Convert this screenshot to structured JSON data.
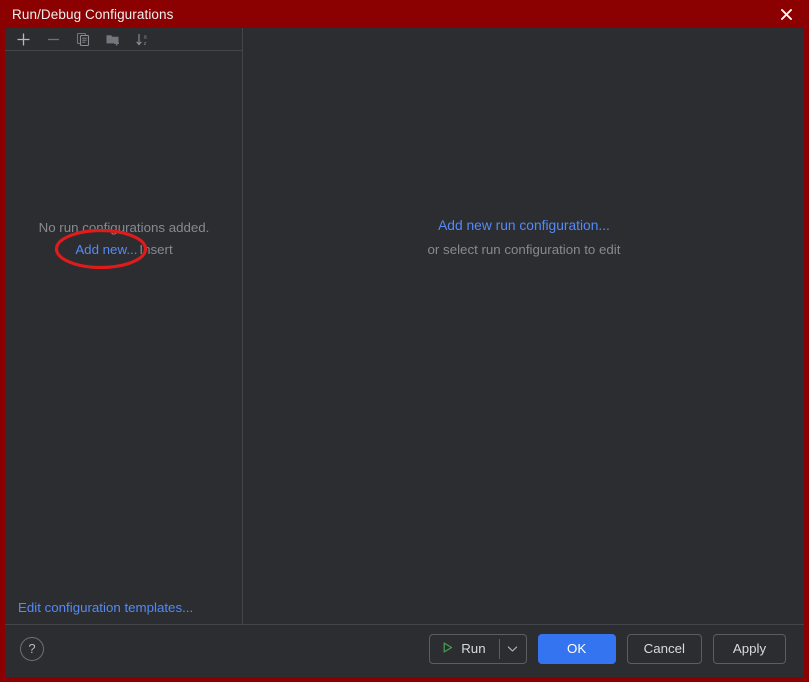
{
  "window": {
    "title": "Run/Debug Configurations",
    "close_icon": "close-icon",
    "titlebar_color": "#8b0000",
    "background_color": "#2b2d30"
  },
  "toolbar": {
    "items": [
      {
        "name": "add-icon",
        "label": "Add New Configuration"
      },
      {
        "name": "remove-icon",
        "label": "Remove Configuration"
      },
      {
        "name": "copy-icon",
        "label": "Copy Configuration"
      },
      {
        "name": "new-folder-icon",
        "label": "Create New Folder"
      },
      {
        "name": "sort-alphabetically-icon",
        "label": "Sort Configurations"
      }
    ]
  },
  "left_panel": {
    "empty_message": "No run configurations added.",
    "add_new_link": "Add new...",
    "add_new_shortcut": "Insert",
    "edit_templates_link": "Edit configuration templates..."
  },
  "right_panel": {
    "primary_link": "Add new run configuration...",
    "subtitle": "or select run configuration to edit"
  },
  "footer": {
    "help_label": "?",
    "run_label": "Run",
    "run_dropdown_icon": "chevron-down-icon",
    "ok_label": "OK",
    "cancel_label": "Cancel",
    "apply_label": "Apply"
  },
  "colors": {
    "accent_link": "#548af7",
    "primary_button": "#3574f0",
    "annotation": "#e01b1b",
    "muted_text": "#868a91",
    "run_icon_green": "#499c54"
  }
}
